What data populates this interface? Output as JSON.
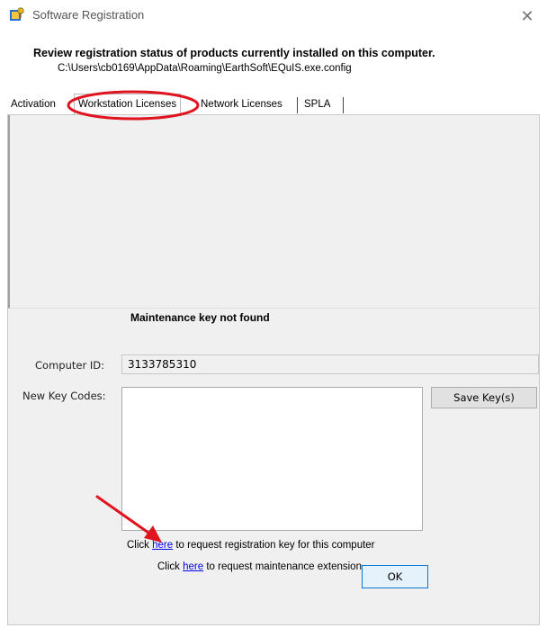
{
  "window": {
    "title": "Software Registration",
    "close_glyph": "✕"
  },
  "header": {
    "heading": "Review registration status of products currently installed on this computer.",
    "config_path": "C:\\Users\\cb0169\\AppData\\Roaming\\EarthSoft\\EQuIS.exe.config"
  },
  "tabs": [
    {
      "label": "Activation"
    },
    {
      "label": "Workstation Licenses"
    },
    {
      "label": "Network Licenses"
    },
    {
      "label": "SPLA"
    }
  ],
  "active_tab": "Workstation Licenses",
  "panel": {
    "maintenance_message": "Maintenance key not found",
    "computer_id_label": "Computer ID:",
    "computer_id_value": "3133785310",
    "new_key_codes_label": "New Key Codes:",
    "new_key_codes_value": "",
    "save_button": "Save Key(s)",
    "link1": {
      "prefix": "Click ",
      "link": "here",
      "suffix": " to request registration key for this computer"
    },
    "link2": {
      "prefix": "Click ",
      "link": "here",
      "suffix": " to request maintenance extension"
    },
    "ok_button": "OK"
  },
  "annotations": {
    "highlight_color": "#e0141e",
    "arrow_color": "#e0141e"
  },
  "icons": [
    "app-registration-icon",
    "close-icon"
  ]
}
